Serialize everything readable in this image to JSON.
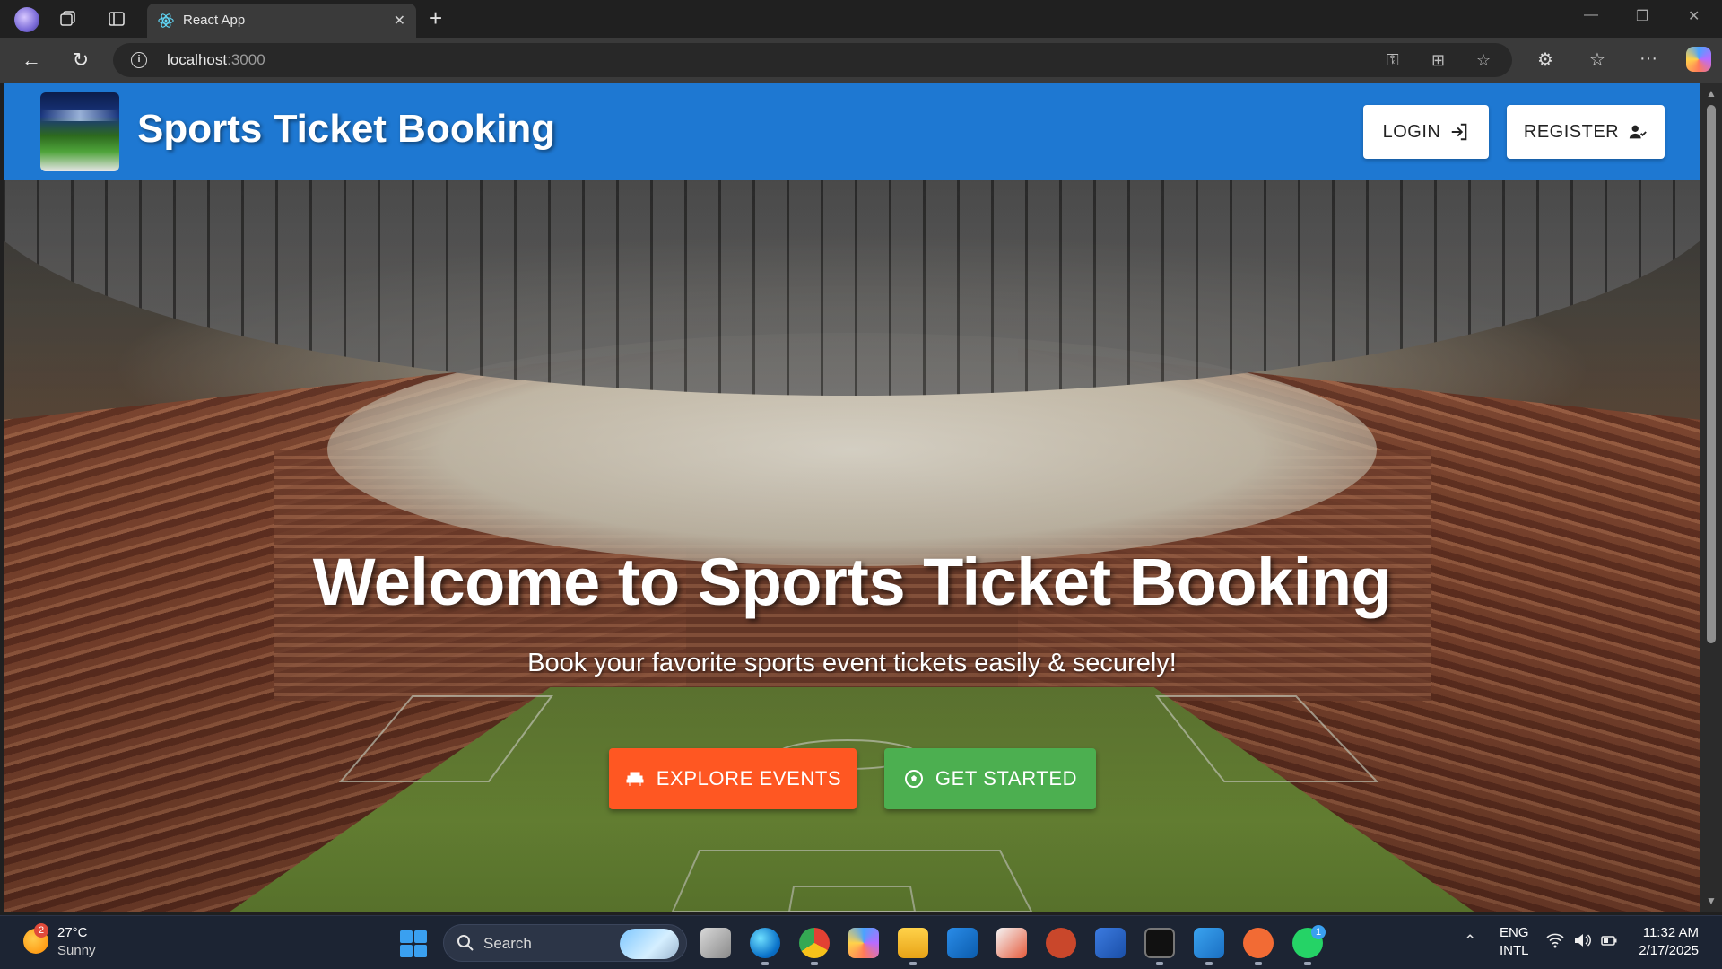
{
  "browser": {
    "tab_title": "React App",
    "url_host": "localhost",
    "url_port": ":3000"
  },
  "app": {
    "brand": "Sports Ticket Booking",
    "login_label": "LOGIN",
    "register_label": "REGISTER",
    "primary_color": "#1e78d2"
  },
  "hero": {
    "title": "Welcome to Sports Ticket Booking",
    "subtitle": "Book your favorite sports event tickets easily & securely!",
    "explore_label": "EXPLORE EVENTS",
    "started_label": "GET STARTED",
    "explore_color": "#ff5722",
    "started_color": "#4caf50"
  },
  "taskbar": {
    "weather_temp": "27°C",
    "weather_cond": "Sunny",
    "weather_badge": "2",
    "search_label": "Search",
    "whatsapp_badge": "1",
    "lang": "ENG",
    "layout": "INTL",
    "time": "11:32 AM",
    "date": "2/17/2025"
  }
}
